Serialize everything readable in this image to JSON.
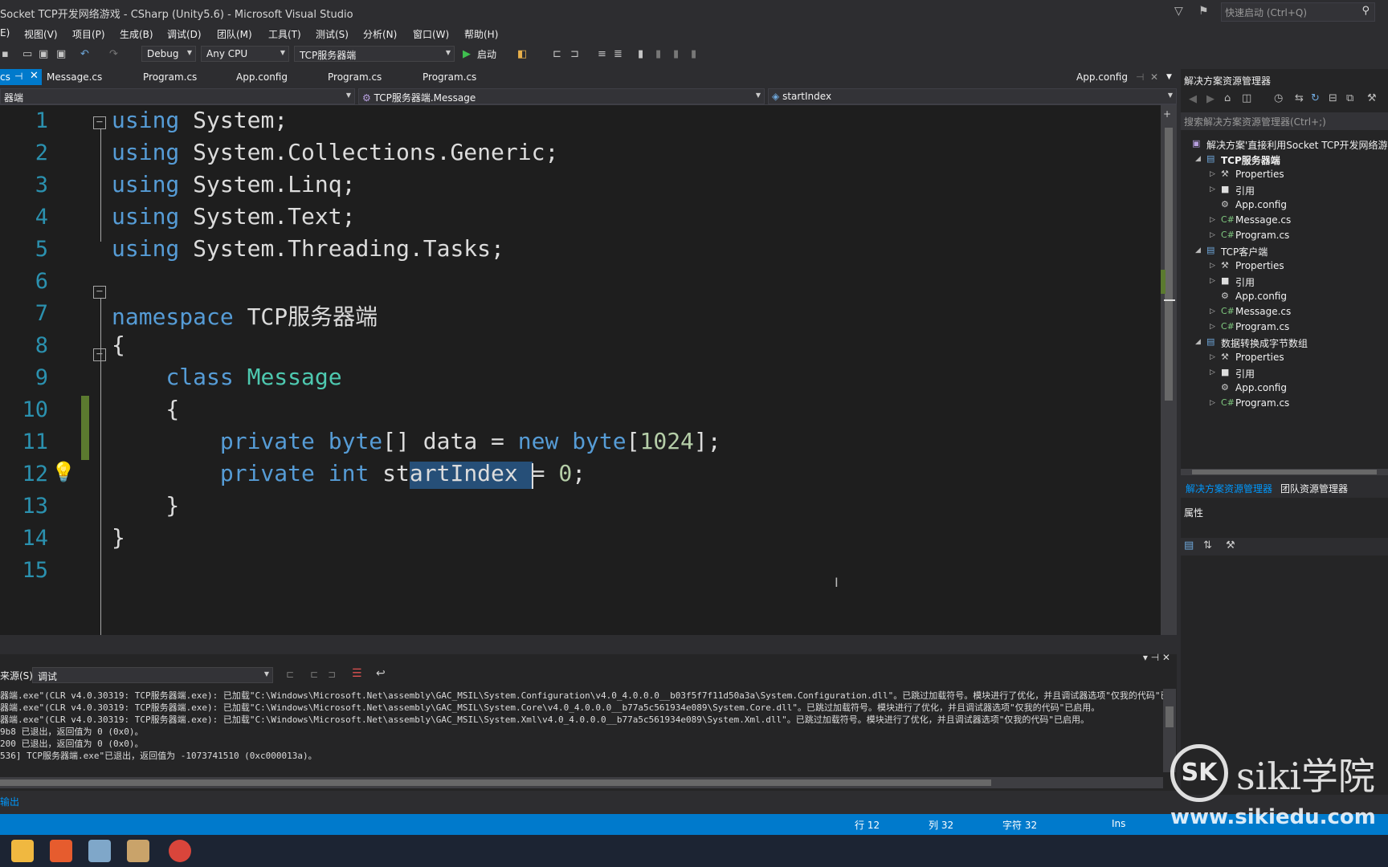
{
  "window": {
    "title": "Socket TCP开发网络游戏 - CSharp (Unity5.6) - Microsoft Visual Studio",
    "quick_launch_placeholder": "快速启动 (Ctrl+Q)"
  },
  "menu": [
    "E)",
    "视图(V)",
    "项目(P)",
    "生成(B)",
    "调试(D)",
    "团队(M)",
    "工具(T)",
    "测试(S)",
    "分析(N)",
    "窗口(W)",
    "帮助(H)"
  ],
  "toolbar": {
    "configuration": "Debug",
    "platform": "Any CPU",
    "startup_project": "TCP服务器端",
    "start_label": "启动"
  },
  "tabs": {
    "active": "cs",
    "items": [
      "Message.cs",
      "Program.cs",
      "App.config",
      "Program.cs",
      "Program.cs"
    ],
    "right": "App.config"
  },
  "navbar": {
    "project": "器端",
    "type": "TCP服务器端.Message",
    "member": "startIndex"
  },
  "editor": {
    "line_numbers": [
      "1",
      "2",
      "3",
      "4",
      "5",
      "6",
      "7",
      "8",
      "9",
      "10",
      "11",
      "12",
      "13",
      "14",
      "15"
    ],
    "lines": [
      [
        {
          "t": "using",
          "c": "kw"
        },
        {
          "t": " System;",
          "c": ""
        }
      ],
      [
        {
          "t": "using",
          "c": "kw"
        },
        {
          "t": " System.Collections.Generic;",
          "c": ""
        }
      ],
      [
        {
          "t": "using",
          "c": "kw"
        },
        {
          "t": " System.Linq;",
          "c": ""
        }
      ],
      [
        {
          "t": "using",
          "c": "kw"
        },
        {
          "t": " System.Text;",
          "c": ""
        }
      ],
      [
        {
          "t": "using",
          "c": "kw"
        },
        {
          "t": " System.Threading.Tasks;",
          "c": ""
        }
      ],
      [],
      [
        {
          "t": "namespace",
          "c": "kw"
        },
        {
          "t": " TCP服务器端",
          "c": ""
        }
      ],
      [
        {
          "t": "{",
          "c": ""
        }
      ],
      [
        {
          "t": "    ",
          "c": ""
        },
        {
          "t": "class",
          "c": "kw"
        },
        {
          "t": " ",
          "c": ""
        },
        {
          "t": "Message",
          "c": "ty"
        }
      ],
      [
        {
          "t": "    {",
          "c": ""
        }
      ],
      [
        {
          "t": "        ",
          "c": ""
        },
        {
          "t": "private",
          "c": "kw"
        },
        {
          "t": " ",
          "c": ""
        },
        {
          "t": "byte",
          "c": "kw"
        },
        {
          "t": "[] data = ",
          "c": ""
        },
        {
          "t": "new",
          "c": "kw"
        },
        {
          "t": " ",
          "c": ""
        },
        {
          "t": "byte",
          "c": "kw"
        },
        {
          "t": "[",
          "c": ""
        },
        {
          "t": "1024",
          "c": "nm"
        },
        {
          "t": "];",
          "c": ""
        }
      ],
      [
        {
          "t": "        ",
          "c": ""
        },
        {
          "t": "private",
          "c": "kw"
        },
        {
          "t": " ",
          "c": ""
        },
        {
          "t": "int",
          "c": "kw"
        },
        {
          "t": " startIndex = ",
          "c": ""
        },
        {
          "t": "0",
          "c": "nm"
        },
        {
          "t": ";",
          "c": ""
        }
      ],
      [
        {
          "t": "    }",
          "c": ""
        }
      ],
      [
        {
          "t": "}",
          "c": ""
        }
      ],
      []
    ]
  },
  "output": {
    "source_label": "来源(S):",
    "source_value": "调试",
    "lines": [
      "器端.exe\"(CLR v4.0.30319: TCP服务器端.exe): 已加载\"C:\\Windows\\Microsoft.Net\\assembly\\GAC_MSIL\\System.Configuration\\v4.0_4.0.0.0__b03f5f7f11d50a3a\\System.Configuration.dll\"。已跳过加载符号。模块进行了优化，并且调试器选项\"仅我的代码\"已启",
      "器端.exe\"(CLR v4.0.30319: TCP服务器端.exe): 已加载\"C:\\Windows\\Microsoft.Net\\assembly\\GAC_MSIL\\System.Core\\v4.0_4.0.0.0__b77a5c561934e089\\System.Core.dll\"。已跳过加载符号。模块进行了优化，并且调试器选项\"仅我的代码\"已启用。",
      "器端.exe\"(CLR v4.0.30319: TCP服务器端.exe): 已加载\"C:\\Windows\\Microsoft.Net\\assembly\\GAC_MSIL\\System.Xml\\v4.0_4.0.0.0__b77a5c561934e089\\System.Xml.dll\"。已跳过加载符号。模块进行了优化，并且调试器选项\"仅我的代码\"已启用。",
      "9b8 已退出，返回值为 0 (0x0)。",
      "200 已退出，返回值为 0 (0x0)。",
      "536] TCP服务器端.exe\"已退出，返回值为 -1073741510 (0xc000013a)。"
    ],
    "tab_label": "输出"
  },
  "status": {
    "line": "行 12",
    "col": "列 32",
    "char": "字符 32",
    "mode": "Ins"
  },
  "solution_explorer": {
    "title": "解决方案资源管理器",
    "search_placeholder": "搜索解决方案资源管理器(Ctrl+;)",
    "solution": "解决方案'直接利用Socket TCP开发网络游",
    "projects": [
      {
        "name": "TCP服务器端",
        "items": [
          "Properties",
          "引用",
          "App.config",
          "Message.cs",
          "Program.cs"
        ]
      },
      {
        "name": "TCP客户端",
        "items": [
          "Properties",
          "引用",
          "App.config",
          "Message.cs",
          "Program.cs"
        ]
      },
      {
        "name": "数据转换成字节数组",
        "items": [
          "Properties",
          "引用",
          "App.config",
          "Program.cs"
        ]
      }
    ],
    "tab_solution": "解决方案资源管理器",
    "tab_team": "团队资源管理器"
  },
  "properties": {
    "title": "属性"
  },
  "watermark": {
    "brand": "siki学院",
    "url": "www.sikiedu.com"
  },
  "colors": {
    "accent": "#007acc",
    "editor_bg": "#1e1e1e",
    "keyword": "#569cd6",
    "type": "#4ec9b0",
    "selection": "#264f78"
  }
}
